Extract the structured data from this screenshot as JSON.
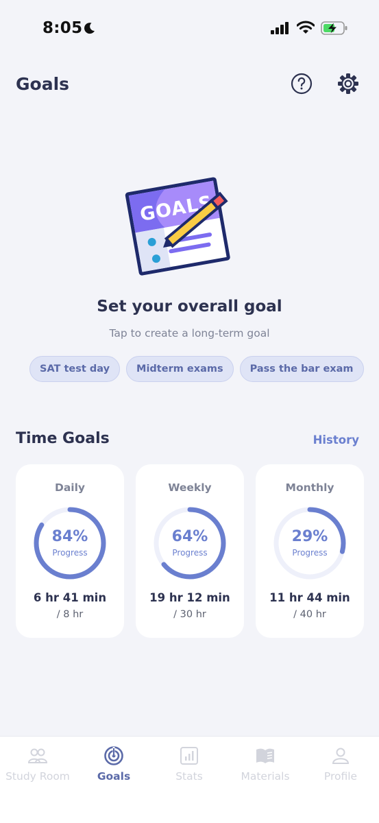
{
  "status_bar": {
    "time": "8:05",
    "icons": [
      "moon-icon",
      "signal-icon",
      "wifi-icon",
      "battery-charging-icon"
    ]
  },
  "header": {
    "title": "Goals",
    "help_icon": "question-circle-icon",
    "settings_icon": "gear-icon"
  },
  "illustration": {
    "text": "GOALS",
    "icon": "goals-notepad-pencil-illustration"
  },
  "overall_goal": {
    "title": "Set your overall goal",
    "subtitle": "Tap to create a long-term goal",
    "suggestions": [
      "SAT test day",
      "Midterm exams",
      "Pass the bar exam"
    ]
  },
  "time_goals": {
    "title": "Time Goals",
    "history_label": "History",
    "cards": [
      {
        "period": "Daily",
        "percent_text": "84%",
        "percent": 84,
        "progress_label": "Progress",
        "time": "6 hr 41 min",
        "target": "/ 8 hr"
      },
      {
        "period": "Weekly",
        "percent_text": "64%",
        "percent": 64,
        "progress_label": "Progress",
        "time": "19 hr 12 min",
        "target": "/ 30 hr"
      },
      {
        "period": "Monthly",
        "percent_text": "29%",
        "percent": 29,
        "progress_label": "Progress",
        "time": "11 hr 44 min",
        "target": "/ 40 hr"
      }
    ]
  },
  "tab_bar": {
    "tabs": [
      {
        "label": "Study Room",
        "icon": "people-icon",
        "active": false
      },
      {
        "label": "Goals",
        "icon": "target-icon",
        "active": true
      },
      {
        "label": "Stats",
        "icon": "chart-icon",
        "active": false
      },
      {
        "label": "Materials",
        "icon": "book-icon",
        "active": false
      },
      {
        "label": "Profile",
        "icon": "person-icon",
        "active": false
      }
    ]
  },
  "colors": {
    "accent": "#6a7fcf",
    "ring_track": "#eef0fa",
    "text_dark": "#2d3250",
    "text_muted": "#7e8396",
    "chip_bg": "#dfe4f6",
    "background": "#f3f4f9",
    "tab_inactive": "#d2d4dc",
    "tab_active": "#5b6aa8"
  }
}
